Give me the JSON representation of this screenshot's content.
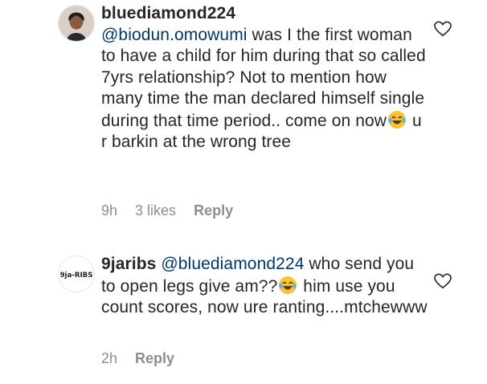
{
  "comments": [
    {
      "username": "bluediamond224",
      "mention": "@biodun.omowumi",
      "text_before_emoji": " was I the first woman to have a child for him during that so called 7yrs relationship? Not to mention how many time the man declared himself single during that time period.. come on now",
      "emoji": "face-with-tears-of-joy-icon",
      "text_after_emoji": " u r barkin at the wrong tree",
      "time": "9h",
      "likes": "3 likes",
      "reply_label": "Reply",
      "avatar": "woman-portrait"
    },
    {
      "username": "9jaribs",
      "avatar_text": "9ja-RIBS",
      "mention": "@bluediamond224",
      "text_before_emoji": " who send you to open legs give am??",
      "emoji": "face-with-tears-of-joy-icon",
      "text_after_emoji": " him use you count scores, now ure ranting....mtchewww",
      "time": "2h",
      "reply_label": "Reply"
    }
  ],
  "colors": {
    "text": "#262626",
    "mention": "#00376b",
    "meta": "#8e8e8e"
  },
  "icons": [
    "heart-outline-icon",
    "face-with-tears-of-joy-icon"
  ]
}
